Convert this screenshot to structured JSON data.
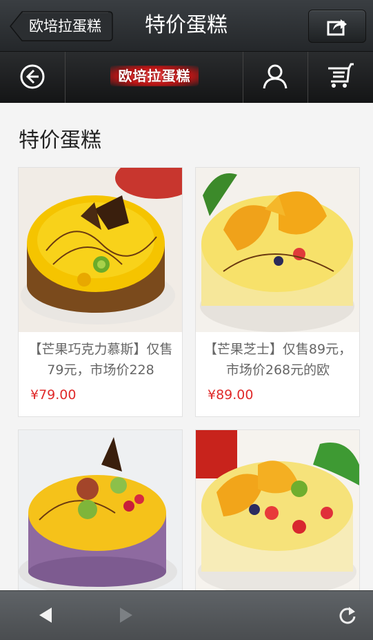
{
  "header": {
    "back_label": "欧培拉蛋糕",
    "title": "特价蛋糕",
    "share_icon": "share-icon"
  },
  "nav": {
    "back_icon": "circle-back-arrow-icon",
    "logo_text": "欧培拉蛋糕",
    "user_icon": "user-icon",
    "cart_icon": "cart-icon"
  },
  "main": {
    "section_title": "特价蛋糕",
    "products": [
      {
        "description": "【芒果巧克力慕斯】仅售79元，市场价228",
        "price": "¥79.00"
      },
      {
        "description": "【芒果芝士】仅售89元，市场价268元的欧",
        "price": "¥89.00"
      },
      {
        "description": "",
        "price": ""
      },
      {
        "description": "",
        "price": ""
      }
    ]
  },
  "browser": {
    "back_icon": "triangle-left-icon",
    "forward_icon": "triangle-right-icon",
    "refresh_icon": "refresh-icon"
  },
  "colors": {
    "price": "#e02a2a",
    "header_bg": "#2f3235",
    "bottom_bg": "#55595c"
  }
}
